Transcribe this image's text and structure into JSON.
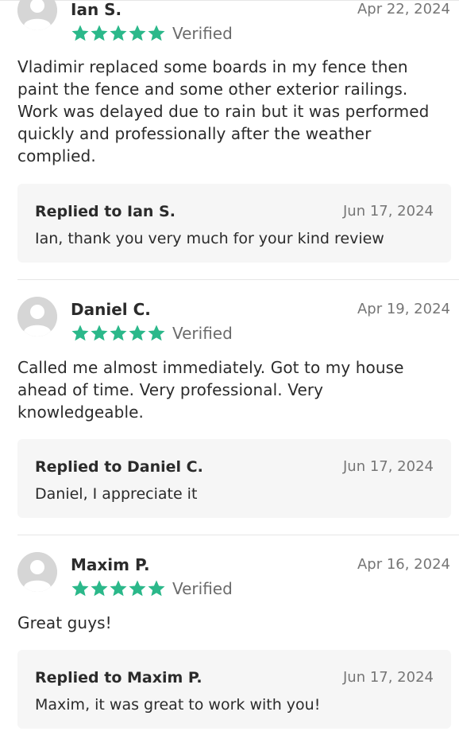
{
  "reviews": [
    {
      "name": "Ian S.",
      "date": "Apr 22, 2024",
      "rating": 5,
      "verified_label": "Verified",
      "text_lines": [
        "Vladimir replaced some boards in my fence then",
        "paint the fence and some other exterior railings.",
        "Work was delayed due to rain but it was performed",
        "quickly and professionally after the weather",
        "complied."
      ],
      "reply": {
        "title": "Replied to Ian S.",
        "date": "Jun 17, 2024",
        "text": "Ian, thank you very much for your kind review"
      }
    },
    {
      "name": "Daniel C.",
      "date": "Apr 19, 2024",
      "rating": 5,
      "verified_label": "Verified",
      "text_lines": [
        "Called me almost immediately. Got to my house",
        "ahead of time. Very professional. Very",
        "knowledgeable."
      ],
      "reply": {
        "title": "Replied to Daniel C.",
        "date": "Jun 17, 2024",
        "text": "Daniel, I appreciate it"
      }
    },
    {
      "name": "Maxim P.",
      "date": "Apr 16, 2024",
      "rating": 5,
      "verified_label": "Verified",
      "text_lines": [
        "Great guys!"
      ],
      "reply": {
        "title": "Replied to Maxim P.",
        "date": "Jun 17, 2024",
        "text": "Maxim, it was great to work with you!"
      }
    }
  ],
  "colors": {
    "star": "#2bb88a",
    "avatar_bg": "#d6d6d6",
    "reply_bg": "#f6f6f6"
  },
  "icons": {
    "avatar": "user-avatar-icon",
    "star": "star-icon"
  }
}
